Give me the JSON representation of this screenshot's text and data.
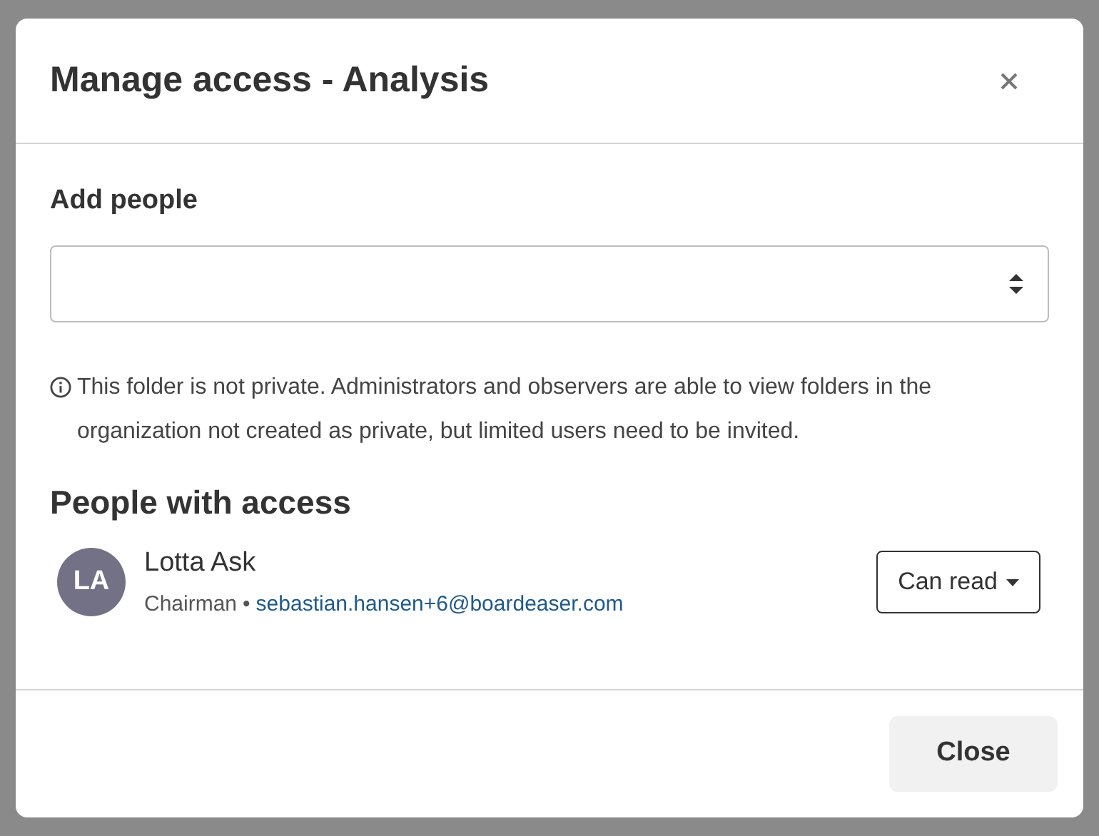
{
  "dialog": {
    "title": "Manage access - Analysis"
  },
  "add_people": {
    "label": "Add people"
  },
  "notice": "This folder is not private. Administrators and observers are able to view folders in the organization not created as private, but limited users need to be invited.",
  "people_heading": "People with access",
  "people": [
    {
      "initials": "LA",
      "name": "Lotta Ask",
      "role": "Chairman",
      "separator": "•",
      "email": "sebastian.hansen+6@boardeaser.com",
      "permission": "Can read"
    }
  ],
  "footer": {
    "close": "Close"
  }
}
